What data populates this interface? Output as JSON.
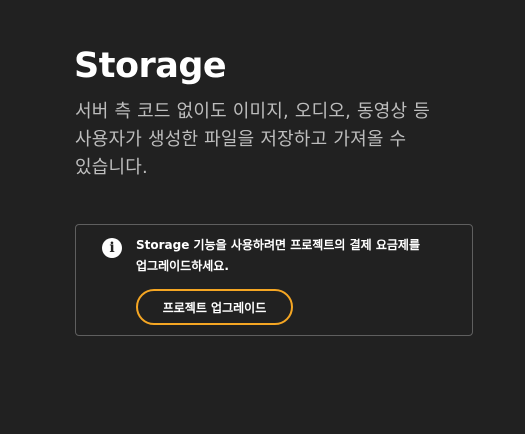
{
  "header": {
    "title": "Storage"
  },
  "intro": {
    "description": "서버 측 코드 없이도 이미지, 오디오, 동영상 등 사용자가 생성한 파일을 저장하고 가져올 수 있습니다."
  },
  "notice": {
    "icon": "info-icon",
    "icon_glyph": "i",
    "message": "Storage 기능을 사용하려면 프로젝트의 결제 요금제를 업그레이드하세요.",
    "button_label": "프로젝트 업그레이드",
    "accent_color": "#f5a623"
  }
}
